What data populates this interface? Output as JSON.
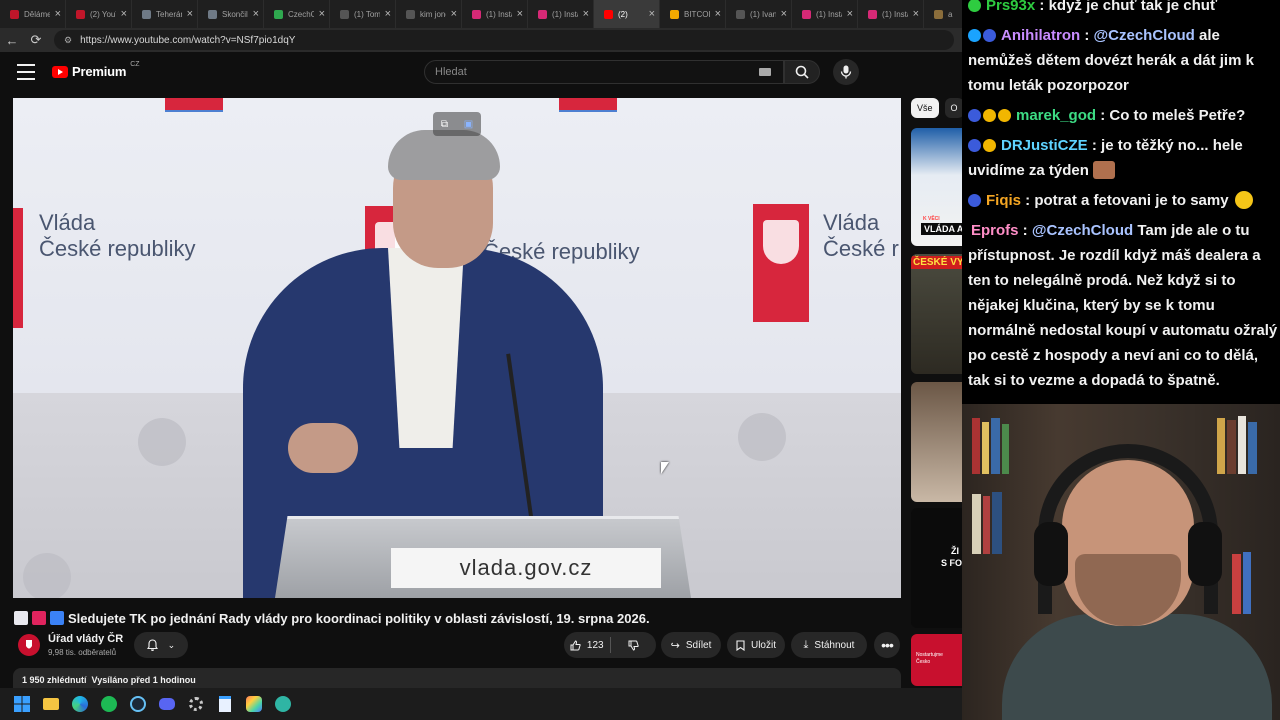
{
  "browser": {
    "tabs": [
      {
        "label": "Děláme",
        "color": "#c0162a",
        "active": false
      },
      {
        "label": "(2) YouT",
        "color": "#c0162a",
        "active": false
      },
      {
        "label": "Teheráné",
        "color": "#6f7a86",
        "active": false
      },
      {
        "label": "Skončil",
        "color": "#6f7a86",
        "active": false
      },
      {
        "label": "CzechCl",
        "color": "#2fa84f",
        "active": false
      },
      {
        "label": "(1) Tom",
        "color": "#555555",
        "active": false
      },
      {
        "label": "kim jong",
        "color": "#555555",
        "active": false
      },
      {
        "label": "(1) Insta",
        "color": "#d62976",
        "active": false
      },
      {
        "label": "(1) Insta",
        "color": "#d62976",
        "active": false
      },
      {
        "label": "(2)",
        "color": "#ff0000",
        "active": true
      },
      {
        "label": "BITCOIN",
        "color": "#f2a900",
        "active": false
      },
      {
        "label": "(1) Ivan",
        "color": "#555555",
        "active": false
      },
      {
        "label": "(1) Insta",
        "color": "#d62976",
        "active": false
      },
      {
        "label": "(1) Insta",
        "color": "#d62976",
        "active": false
      },
      {
        "label": "a",
        "color": "#8a6d3b",
        "active": false
      }
    ],
    "url": "https://www.youtube.com/watch?v=NSf7pio1dqY"
  },
  "youtube": {
    "logo_text": "Premium",
    "logo_region": "CZ",
    "search_placeholder": "Hledat",
    "video": {
      "wall_text_left": [
        "Vláda",
        "České republiky"
      ],
      "wall_text_center": "České republiky",
      "wall_text_right": [
        "Vláda",
        "České r"
      ],
      "lectern_text": "vlada.gov.cz"
    },
    "title": "Sledujete TK po jednání Rady vlády pro koordinaci politiky v oblasti závislostí, 19. srpna 2026.",
    "channel_name": "Úřad vlády ČR",
    "subscribers": "9,98 tis. odběratelů",
    "likes": "123",
    "share_label": "Sdílet",
    "save_label": "Uložit",
    "download_label": "Stáhnout",
    "views": "1 950 zhlédnutí",
    "streamed": "Vysíláno před 1 hodinou",
    "chips": [
      "Vše",
      "O"
    ],
    "thumb_texts": [
      "VLÁDA A",
      "ČESKÉ VY",
      "ŽI",
      "S FO"
    ],
    "thumb_small": [
      "Nostartujme",
      "Česko"
    ],
    "thumb_badge": "K VĚCI"
  },
  "chat": [
    {
      "user": "Prs93x",
      "color": "#2ecc40",
      "badges": [
        "#2ecc40"
      ],
      "text": "když je chuť tak je chuť"
    },
    {
      "user": "Anihilatron",
      "color": "#c88cff",
      "badges": [
        "#1aa3ff",
        "#3b5bdb"
      ],
      "text_parts": [
        {
          "t": "@CzechCloud",
          "mention": true
        },
        {
          "t": " ale nemůžeš dětem dovézt herák a dát jim k tomu leták pozorpozor"
        }
      ]
    },
    {
      "user": "marek_god",
      "color": "#3ddc84",
      "badges": [
        "#3b5bdb",
        "#f2b600",
        "#f2b600"
      ],
      "text": "Co to meleš Petře?"
    },
    {
      "user": "DRJustiCZE",
      "color": "#5fd3ff",
      "badges": [
        "#3b5bdb",
        "#f2b600"
      ],
      "text": "je to těžký no... hele uvidíme za týden",
      "emote": true
    },
    {
      "user": "Fiqis",
      "color": "#f5a623",
      "badges": [
        "#3b5bdb"
      ],
      "text": "potrat a fetovani je to samy",
      "emote2": true
    },
    {
      "user": "Eprofs",
      "color": "#ff8ec7",
      "badges": [],
      "text_parts": [
        {
          "t": "@CzechCloud",
          "mention": true
        },
        {
          "t": " Tam jde ale o tu přístupnost. Je rozdíl když máš dealera a ten to nelegálně prodá. Než když si to nějakej klučina, který by se k tomu normálně nedostal koupí v automatu ožralý po cestě z hospody a neví ani co to dělá, tak si to vezme a dopadá to špatně."
        }
      ]
    }
  ],
  "colors": {
    "yt_red": "#ff0000",
    "mention": "#a9c3ff",
    "gov_red": "#d7263d",
    "gov_blue": "#4d7fd1"
  }
}
